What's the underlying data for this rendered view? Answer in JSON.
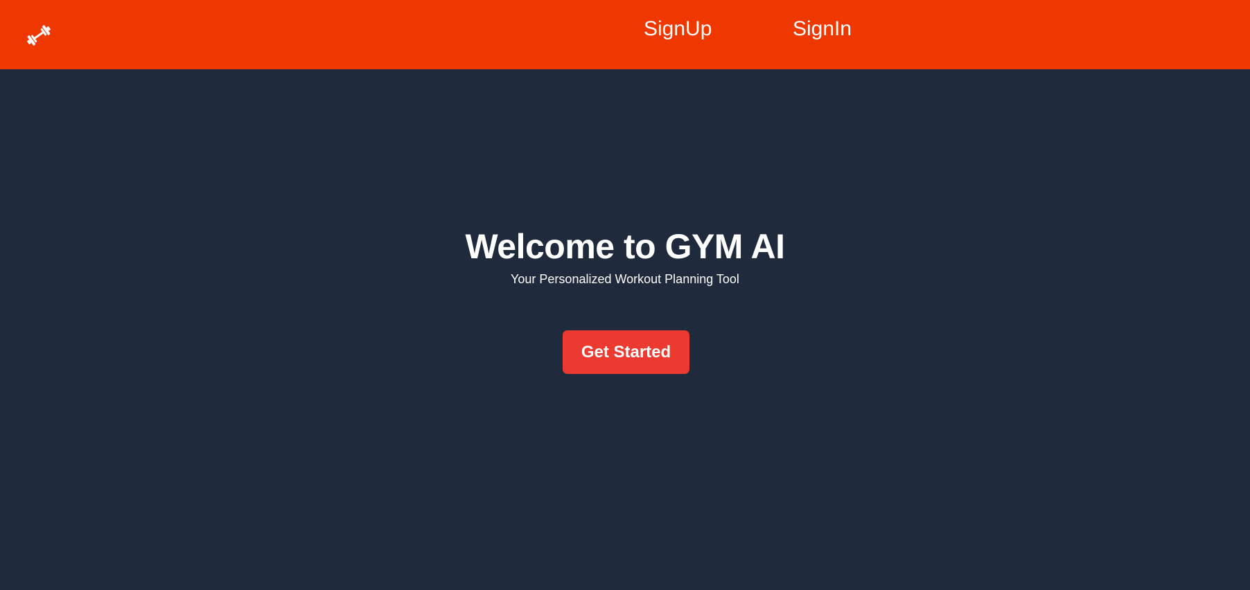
{
  "nav": {
    "logo_icon": "dumbbell-icon",
    "signup_label": "SignUp",
    "signin_label": "SignIn"
  },
  "hero": {
    "title": "Welcome to GYM AI",
    "subtitle": "Your Personalized Workout Planning Tool",
    "cta_label": "Get Started"
  },
  "colors": {
    "navbar_bg": "#ee3800",
    "page_bg": "#1f2a3d",
    "cta_bg": "#ec3a31",
    "text": "#ffffff"
  }
}
